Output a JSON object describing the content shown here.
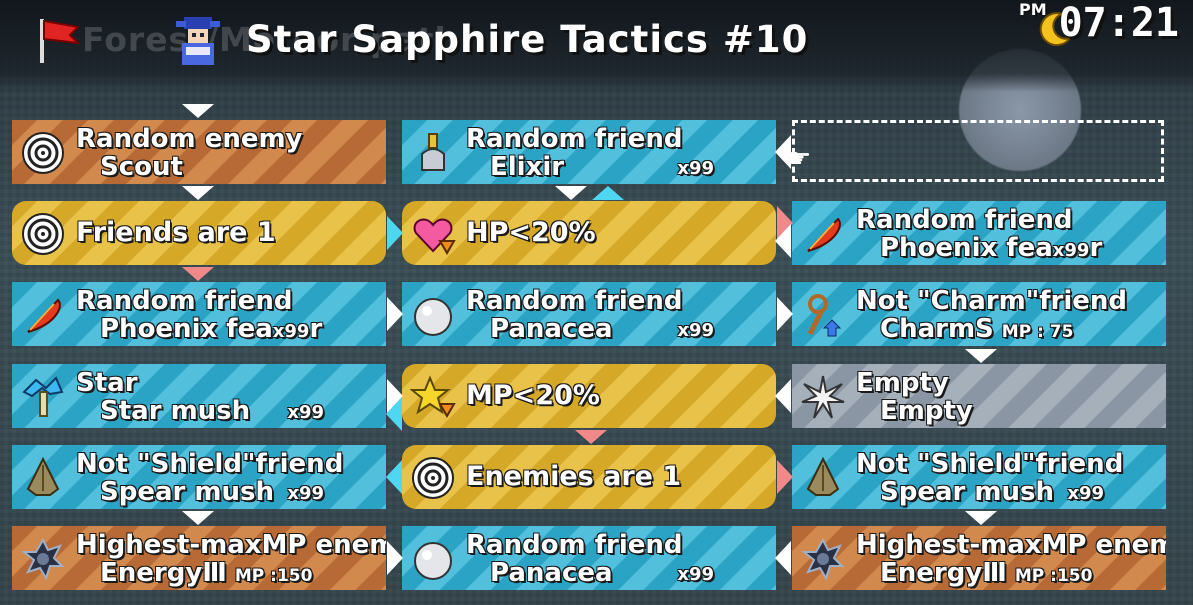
{
  "header": {
    "breadcrumb": "Forest/Meteor path",
    "title": "Star Sapphire Tactics #10",
    "clock_period": "PM",
    "clock_time": "07:21"
  },
  "columns": [
    [
      {
        "line1": "Random enemy",
        "line2": "Scout",
        "color": "orange",
        "icon": "target-icon"
      },
      {
        "single": "Friends are 1",
        "color": "yellow",
        "icon": "target-icon"
      },
      {
        "line1": "Random friend",
        "line2": "Phoenix fea",
        "qty": "x99",
        "suffix": "r",
        "color": "teal",
        "icon": "phoenix-feather-icon"
      },
      {
        "line1": "Star",
        "line2": "Star mush",
        "qty": "x99",
        "color": "teal",
        "icon": "star-mushroom-icon"
      },
      {
        "line1": "Not \"Shield\"friend",
        "line2": "Spear mush",
        "qty": "x99",
        "color": "teal",
        "icon": "spear-mushroom-icon"
      },
      {
        "line1": "Highest-maxMP enemy",
        "line2": "EnergyⅢ",
        "mp": "MP :150",
        "color": "orange",
        "icon": "energy-orb-icon"
      }
    ],
    [
      {
        "line1": "Random friend",
        "line2": "Elixir",
        "qty": "x99",
        "color": "teal",
        "icon": "elixir-bottle-icon"
      },
      {
        "single": "HP<20%",
        "color": "yellow",
        "icon": "heart-down-icon"
      },
      {
        "line1": "Random friend",
        "line2": "Panacea",
        "qty": "x99",
        "color": "teal",
        "icon": "pearl-icon"
      },
      {
        "single": "MP<20%",
        "color": "yellow",
        "icon": "star-down-icon"
      },
      {
        "single": "Enemies are 1",
        "color": "yellow",
        "icon": "target-icon"
      },
      {
        "line1": "Random friend",
        "line2": "Panacea",
        "qty": "x99",
        "color": "teal",
        "icon": "pearl-icon"
      }
    ],
    [
      {
        "empty": true
      },
      {
        "line1": "Random friend",
        "line2": "Phoenix fea",
        "qty": "x99",
        "suffix": "r",
        "color": "teal",
        "icon": "phoenix-feather-icon"
      },
      {
        "line1": "Not \"Charm\"friend",
        "line2": "CharmS",
        "mp": "MP : 75",
        "color": "teal",
        "icon": "charm-staff-icon"
      },
      {
        "line1": "Empty",
        "line2": "Empty",
        "color": "gray",
        "icon": "empty-sparkle-icon"
      },
      {
        "line1": "Not \"Shield\"friend",
        "line2": "Spear mush",
        "qty": "x99",
        "color": "teal",
        "icon": "spear-mushroom-icon"
      },
      {
        "line1": "Highest-maxMP enemy",
        "line2": "EnergyⅢ",
        "mp": "MP :150",
        "color": "orange",
        "icon": "energy-orb-icon"
      }
    ]
  ],
  "colors": {
    "teal": "#2aa3c4",
    "orange": "#c47a40",
    "yellow": "#dfb53a",
    "gray": "#98a3af",
    "cyan_arrow": "#4fd7f2",
    "pink_arrow": "#f08a8a"
  }
}
